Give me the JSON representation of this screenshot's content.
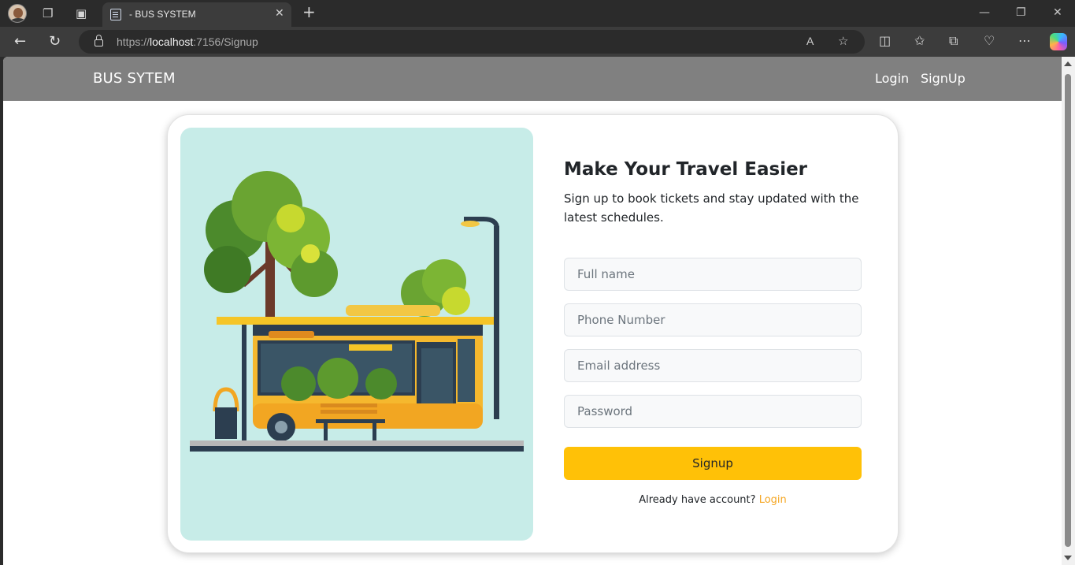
{
  "browser": {
    "tab_title": "- BUS SYSTEM",
    "url_scheme": "https://",
    "url_host": "localhost",
    "url_rest": ":7156/Signup"
  },
  "nav": {
    "brand": "BUS SYTEM",
    "links": [
      "Login",
      "SignUp"
    ]
  },
  "signup": {
    "heading": "Make Your Travel Easier",
    "subtext": "Sign up to book tickets and stay updated with the latest schedules.",
    "fields": [
      {
        "placeholder": "Full name",
        "value": ""
      },
      {
        "placeholder": "Phone Number",
        "value": ""
      },
      {
        "placeholder": "Email address",
        "value": ""
      },
      {
        "placeholder": "Password",
        "value": ""
      }
    ],
    "submit_label": "Signup",
    "login_prompt": "Already have account?",
    "login_link": "Login"
  },
  "colors": {
    "navbar": "#808080",
    "accent": "#ffc107",
    "link": "#f5a623",
    "illustration_bg": "#c7ece8"
  }
}
